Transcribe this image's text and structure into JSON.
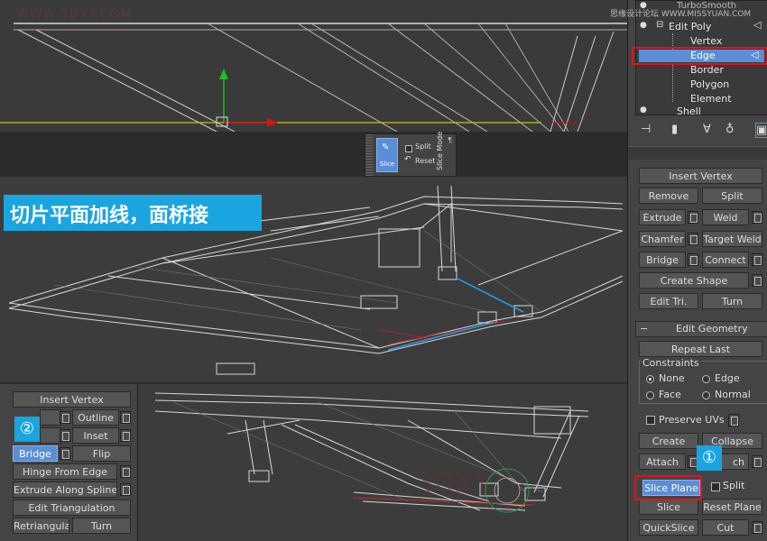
{
  "watermarks": {
    "left": "WWW.3DXY.COM",
    "right": "思缘设计论坛 WWW.MISSYUAN.COM"
  },
  "modifier_stack": {
    "items": [
      {
        "label": "TurboSmooth"
      },
      {
        "label": "Edit Poly"
      },
      {
        "label": "Vertex"
      },
      {
        "label": "Edge"
      },
      {
        "label": "Border"
      },
      {
        "label": "Polygon"
      },
      {
        "label": "Element"
      },
      {
        "label": "Shell"
      }
    ]
  },
  "slice_mode_toolbar": {
    "slice_label": "Slice",
    "split_label": "Split",
    "reset_label": "Reset",
    "title": "Slice Mode"
  },
  "caption": "切片平面加线，面桥接",
  "edit_edges": {
    "insert_vertex": "Insert Vertex",
    "remove": "Remove",
    "split": "Split",
    "extrude": "Extrude",
    "weld": "Weld",
    "chamfer": "Chamfer",
    "target_weld": "Target Weld",
    "bridge": "Bridge",
    "connect": "Connect",
    "create_shape": "Create Shape",
    "edit_tri": "Edit Tri.",
    "turn": "Turn"
  },
  "edit_geometry": {
    "title": "Edit Geometry",
    "repeat_last": "Repeat Last",
    "constraints": "Constraints",
    "none": "None",
    "edge": "Edge",
    "face": "Face",
    "normal": "Normal",
    "preserve_uvs": "Preserve UVs",
    "create": "Create",
    "collapse": "Collapse",
    "attach": "Attach",
    "detach_partial": "ch",
    "slice_plane": "Slice Plane",
    "split": "Split",
    "slice": "Slice",
    "reset_plane": "Reset Plane",
    "quickslice": "QuickSlice",
    "cut": "Cut"
  },
  "edit_polygons": {
    "insert_vertex": "Insert Vertex",
    "outline": "Outline",
    "inset": "Inset",
    "bridge": "Bridge",
    "flip": "Flip",
    "hinge_from_edge": "Hinge From Edge",
    "extrude_along_spline": "Extrude Along Spline",
    "edit_triangulation": "Edit Triangulation",
    "retriangulate": "Retriangulate",
    "turn": "Turn"
  },
  "badges": {
    "one": "①",
    "two": "②"
  },
  "colors": {
    "accent_blue": "#1aa5e0",
    "highlight_red": "#e8101a",
    "selected_button": "#5a8ed6"
  }
}
